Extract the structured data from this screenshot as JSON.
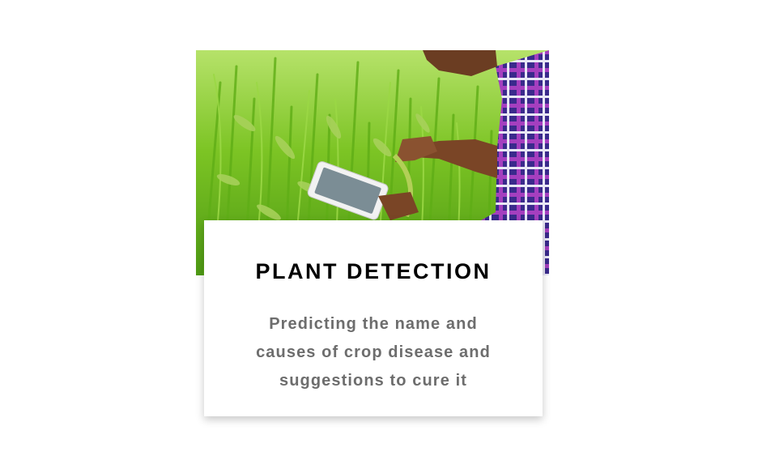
{
  "card": {
    "image_alt": "Farmer using a tablet in a rice field",
    "title": "PLANT DETECTION",
    "description": "Predicting the name and causes of crop disease and suggestions to cure it"
  },
  "colors": {
    "title": "#000000",
    "description": "#6d6d6d",
    "card_background": "#ffffff",
    "field_green": "#7cc424"
  }
}
